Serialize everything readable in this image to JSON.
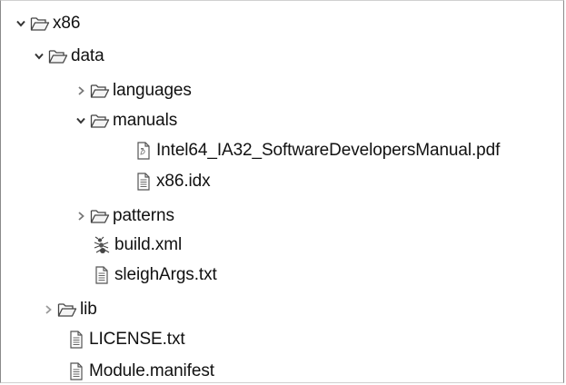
{
  "tree": {
    "items": [
      {
        "label": "x86",
        "type": "folder",
        "level": 0,
        "state": "expanded"
      },
      {
        "label": "data",
        "type": "folder",
        "level": 1,
        "state": "expanded"
      },
      {
        "label": "languages",
        "type": "folder",
        "level": 2,
        "state": "collapsed"
      },
      {
        "label": "manuals",
        "type": "folder",
        "level": 2,
        "state": "expanded"
      },
      {
        "label": "Intel64_IA32_SoftwareDevelopersManual.pdf",
        "type": "pdf",
        "level": 3,
        "state": "leaf"
      },
      {
        "label": "x86.idx",
        "type": "text",
        "level": 3,
        "state": "leaf"
      },
      {
        "label": "patterns",
        "type": "folder",
        "level": 2,
        "state": "collapsed"
      },
      {
        "label": "build.xml",
        "type": "ant",
        "level": 2,
        "state": "leaf"
      },
      {
        "label": "sleighArgs.txt",
        "type": "text",
        "level": 2,
        "state": "leaf"
      },
      {
        "label": "lib",
        "type": "folder",
        "level": 1,
        "state": "collapsed"
      },
      {
        "label": "LICENSE.txt",
        "type": "text",
        "level": 1,
        "state": "leaf"
      },
      {
        "label": "Module.manifest",
        "type": "text",
        "level": 1,
        "state": "leaf"
      }
    ]
  },
  "icons": {
    "expanded": "chevron-down-icon",
    "collapsed": "chevron-right-icon",
    "folder": "open-folder-icon",
    "text": "text-file-icon",
    "pdf": "pdf-file-icon",
    "ant": "ant-build-icon"
  }
}
